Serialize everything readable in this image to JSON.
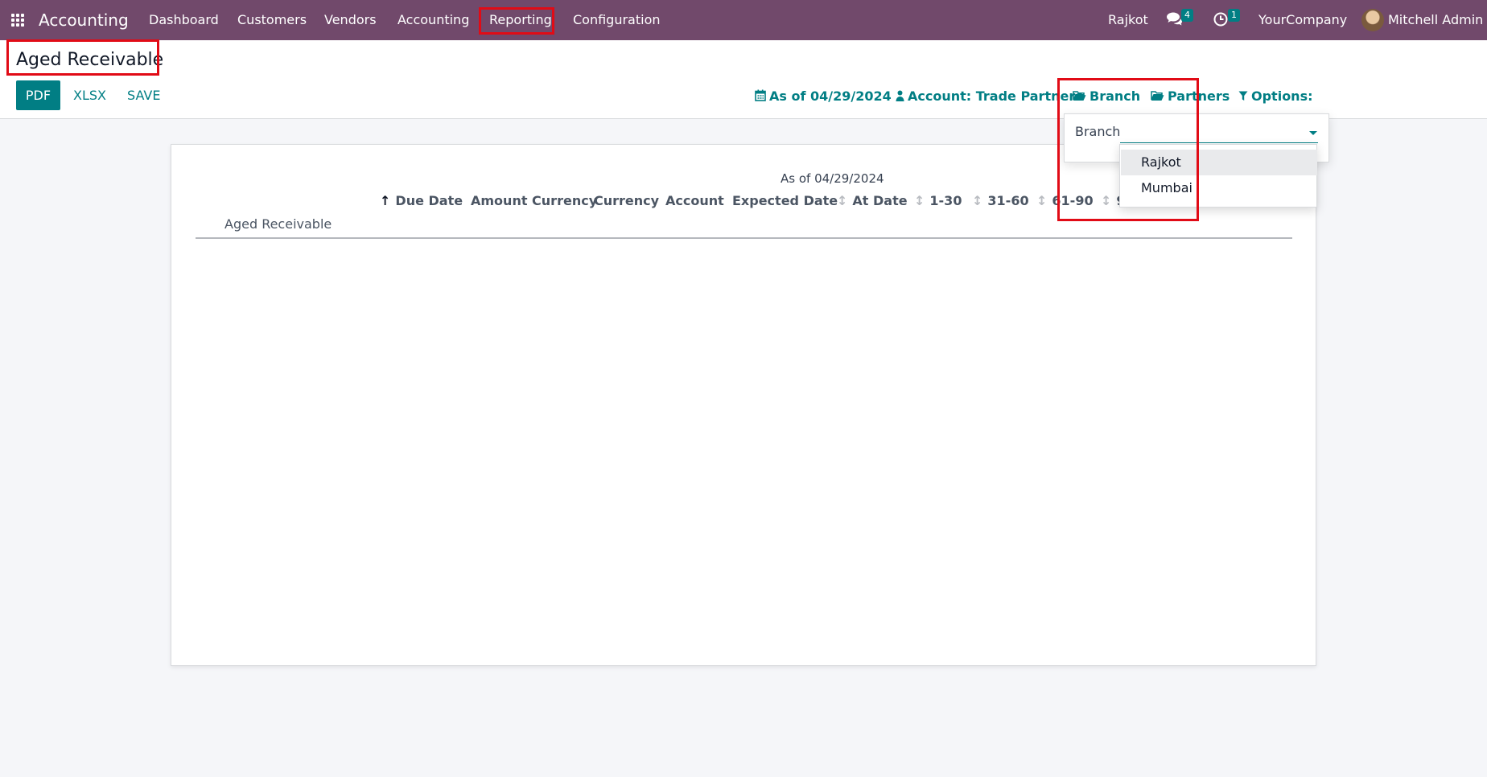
{
  "navbar": {
    "app_name": "Accounting",
    "menu": [
      "Dashboard",
      "Customers",
      "Vendors",
      "Accounting",
      "Reporting",
      "Configuration"
    ],
    "branch": "Rajkot",
    "messages_count": "4",
    "activities_count": "1",
    "company": "YourCompany",
    "user": "Mitchell Admin"
  },
  "control_panel": {
    "title": "Aged Receivable",
    "buttons": [
      "PDF",
      "XLSX",
      "SAVE"
    ],
    "filters": {
      "date": "As of 04/29/2024",
      "account": "Account: Trade Partners",
      "branch": "Branch",
      "partners": "Partners",
      "options": "Options:"
    }
  },
  "report": {
    "date_header": "As of 04/29/2024",
    "columns": [
      "Due Date",
      "Amount Currency",
      "Currency",
      "Account",
      "Expected Date",
      "At Date",
      "1-30",
      "31-60",
      "61-90",
      "9"
    ],
    "row_label": "Aged Receivable"
  },
  "branch_dropdown": {
    "label": "Branch",
    "options": [
      "Rajkot",
      "Mumbai"
    ],
    "highlighted_option": "Rajkot"
  },
  "colors": {
    "navbar": "#71496b",
    "accent": "#017e84",
    "highlight_frame": "#e10b16"
  },
  "icons": [
    "apps-grid-icon",
    "chat-icon",
    "clock-icon",
    "calendar-icon",
    "user-icon",
    "folder-open-icon",
    "filter-icon",
    "sort-icon",
    "caret-down-icon"
  ]
}
